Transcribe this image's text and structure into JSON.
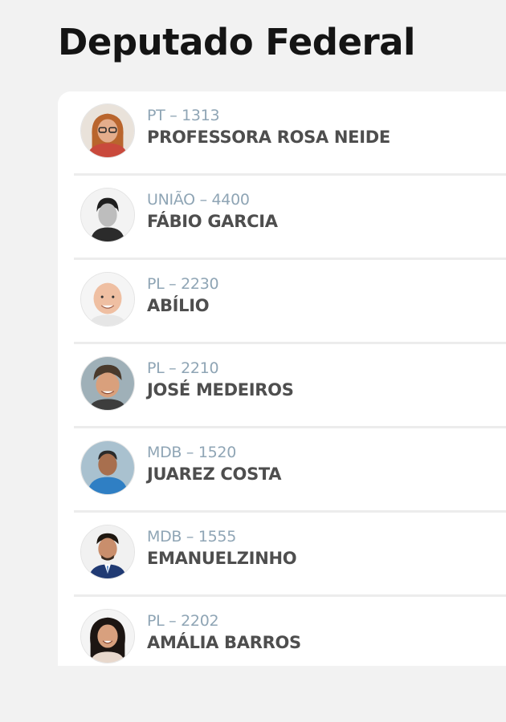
{
  "page": {
    "title": "Deputado Federal"
  },
  "candidates": [
    {
      "party": "PT – 1313",
      "name": "PROFESSORA ROSA NEIDE",
      "avatar_icon": "candidate-photo"
    },
    {
      "party": "UNIÃO – 4400",
      "name": "FÁBIO GARCIA",
      "avatar_icon": "candidate-photo"
    },
    {
      "party": "PL – 2230",
      "name": "ABÍLIO",
      "avatar_icon": "candidate-photo"
    },
    {
      "party": "PL – 2210",
      "name": "JOSÉ MEDEIROS",
      "avatar_icon": "candidate-photo"
    },
    {
      "party": "MDB – 1520",
      "name": "JUAREZ COSTA",
      "avatar_icon": "candidate-photo"
    },
    {
      "party": "MDB – 1555",
      "name": "EMANUELZINHO",
      "avatar_icon": "candidate-photo"
    },
    {
      "party": "PL – 2202",
      "name": "AMÁLIA BARROS",
      "avatar_icon": "candidate-photo"
    }
  ],
  "colors": {
    "background": "#f2f2f2",
    "card": "#ffffff",
    "party_text": "#8fa5b5",
    "name_text": "#4e4e4e"
  }
}
